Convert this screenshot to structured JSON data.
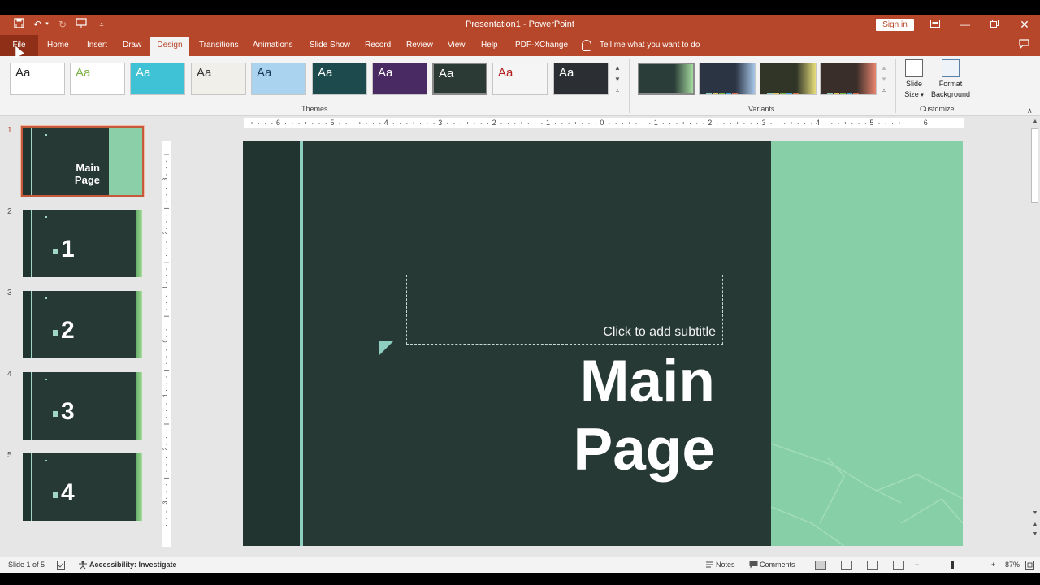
{
  "app": {
    "window_title": "Presentation1  -  PowerPoint",
    "sign_in": "Sign in"
  },
  "quick_access": {
    "icons": [
      "save-icon",
      "undo-icon",
      "redo-icon",
      "present-icon",
      "customize-icon"
    ]
  },
  "tabs": [
    {
      "label": "File"
    },
    {
      "label": "Home"
    },
    {
      "label": "Insert"
    },
    {
      "label": "Draw"
    },
    {
      "label": "Design"
    },
    {
      "label": "Transitions"
    },
    {
      "label": "Animations"
    },
    {
      "label": "Slide Show"
    },
    {
      "label": "Record"
    },
    {
      "label": "Review"
    },
    {
      "label": "View"
    },
    {
      "label": "Help"
    },
    {
      "label": "PDF-XChange"
    }
  ],
  "active_tab": "Design",
  "tell_me": "Tell me what you want to do",
  "ribbon": {
    "themes_label": "Themes",
    "variants_label": "Variants",
    "customize_label": "Customize",
    "theme_sample": "Aa",
    "slide_size_l1": "Slide",
    "slide_size_l2": "Size",
    "format_bg_l1": "Format",
    "format_bg_l2": "Background"
  },
  "themes": [
    {
      "bg": "#ffffff",
      "fg": "#222222"
    },
    {
      "bg": "#ffffff",
      "fg": "#7cb342"
    },
    {
      "bg": "#3fc1d6",
      "fg": "#ffffff"
    },
    {
      "bg": "#f0efe9",
      "fg": "#333333"
    },
    {
      "bg": "#a9d3ee",
      "fg": "#1b3b5a"
    },
    {
      "bg": "#1d4a4d",
      "fg": "#ffffff"
    },
    {
      "bg": "#4a2a63",
      "fg": "#ffffff"
    },
    {
      "bg": "#2c3a36",
      "fg": "#ffffff"
    },
    {
      "bg": "#f5f5f5",
      "fg": "#b21e1e"
    },
    {
      "bg": "#2b2f33",
      "fg": "#ffffff"
    }
  ],
  "variants": [
    {
      "bg": "#2b3d38",
      "accent": "#a6dca0"
    },
    {
      "bg": "#2b3443",
      "accent": "#a6c6e8"
    },
    {
      "bg": "#303528",
      "accent": "#e6dd7a"
    },
    {
      "bg": "#3a2e2a",
      "accent": "#e8836c"
    }
  ],
  "slides": [
    {
      "number": "1",
      "title": "Main Page"
    },
    {
      "number": "2",
      "title": "1"
    },
    {
      "number": "3",
      "title": "2"
    },
    {
      "number": "4",
      "title": "3"
    },
    {
      "number": "5",
      "title": "4"
    }
  ],
  "ruler": {
    "h_labels": [
      "6",
      "5",
      "4",
      "3",
      "2",
      "1",
      "0",
      "1",
      "2",
      "3",
      "4",
      "5",
      "6"
    ],
    "v_labels": [
      "3",
      "2",
      "1",
      "0",
      "1",
      "2",
      "3"
    ]
  },
  "slide_content": {
    "subtitle_placeholder": "Click to add subtitle",
    "title_line1": "Main",
    "title_line2": "Page"
  },
  "status": {
    "slide_info": "Slide 1 of 5",
    "accessibility": "Accessibility: Investigate",
    "notes": "Notes",
    "comments": "Comments",
    "zoom": "87%"
  },
  "colors": {
    "accent": "#b7472a",
    "slide_bg": "#263935",
    "slide_green": "#87cfa6"
  }
}
